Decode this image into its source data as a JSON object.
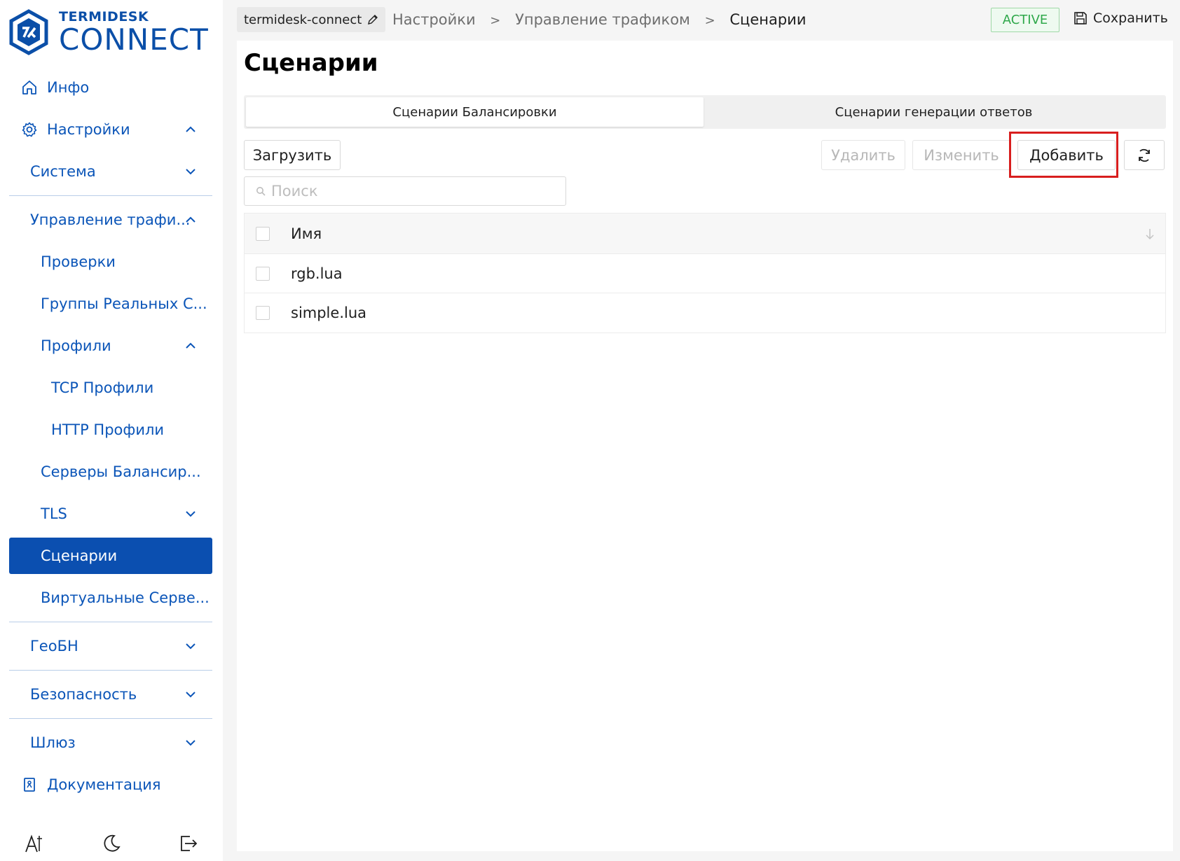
{
  "logo": {
    "small": "TERMIDESK",
    "big": "CONNECT"
  },
  "sidebar": {
    "info": "Инфо",
    "settings": "Настройки",
    "system": "Система",
    "traffic": "Управление трафи...",
    "checks": "Проверки",
    "real_server_groups": "Группы Реальных С...",
    "profiles": "Профили",
    "tcp_profiles": "TCP Профили",
    "http_profiles": "HTTP Профили",
    "balancing_servers": "Серверы Балансир...",
    "tls": "TLS",
    "scenarios": "Сценарии",
    "virtual_servers": "Виртуальные Серве...",
    "geo": "ГеоБН",
    "security": "Безопасность",
    "gateway": "Шлюз",
    "docs": "Документация"
  },
  "topbar": {
    "project": "termidesk-connect",
    "breadcrumb": [
      "Настройки",
      "Управление трафиком",
      "Сценарии"
    ],
    "separator": ">",
    "status": "ACTIVE",
    "save": "Сохранить"
  },
  "main": {
    "title": "Сценарии",
    "tabs": [
      "Сценарии Балансировки",
      "Сценарии генерации ответов"
    ],
    "buttons": {
      "upload": "Загрузить",
      "delete": "Удалить",
      "edit": "Изменить",
      "add": "Добавить"
    },
    "search_placeholder": "Поиск",
    "table": {
      "header_name": "Имя",
      "rows": [
        "rgb.lua",
        "simple.lua"
      ]
    }
  },
  "colors": {
    "brand": "#0b4fa8",
    "active_nav": "#0b4fb0",
    "status_green": "#2ea84a",
    "highlight_red": "#d81e1e"
  }
}
